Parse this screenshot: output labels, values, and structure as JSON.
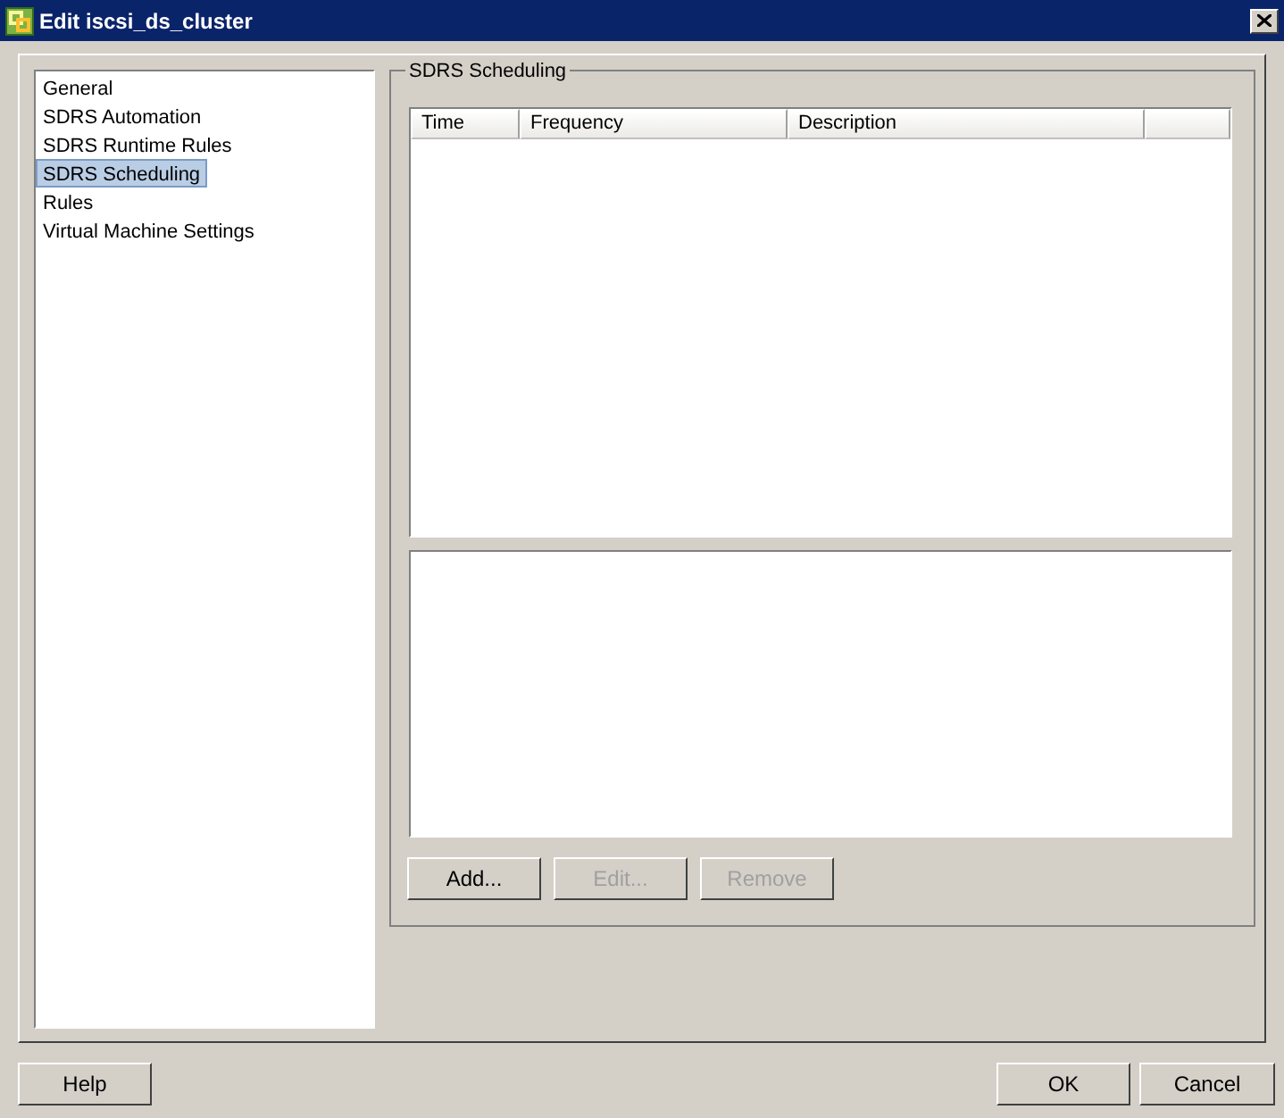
{
  "window": {
    "title": "Edit iscsi_ds_cluster"
  },
  "sidebar": {
    "items": [
      {
        "label": "General",
        "selected": false
      },
      {
        "label": "SDRS Automation",
        "selected": false
      },
      {
        "label": "SDRS Runtime Rules",
        "selected": false
      },
      {
        "label": "SDRS Scheduling",
        "selected": true
      },
      {
        "label": "Rules",
        "selected": false
      },
      {
        "label": "Virtual Machine Settings",
        "selected": false
      }
    ]
  },
  "group": {
    "title": "SDRS Scheduling"
  },
  "table": {
    "columns": [
      "Time",
      "Frequency",
      "Description"
    ]
  },
  "buttons": [
    {
      "label": "Add...",
      "disabled": false
    },
    {
      "label": "Edit...",
      "disabled": true
    },
    {
      "label": "Remove",
      "disabled": true
    }
  ],
  "footer": {
    "help": "Help",
    "ok": "OK",
    "cancel": "Cancel"
  }
}
